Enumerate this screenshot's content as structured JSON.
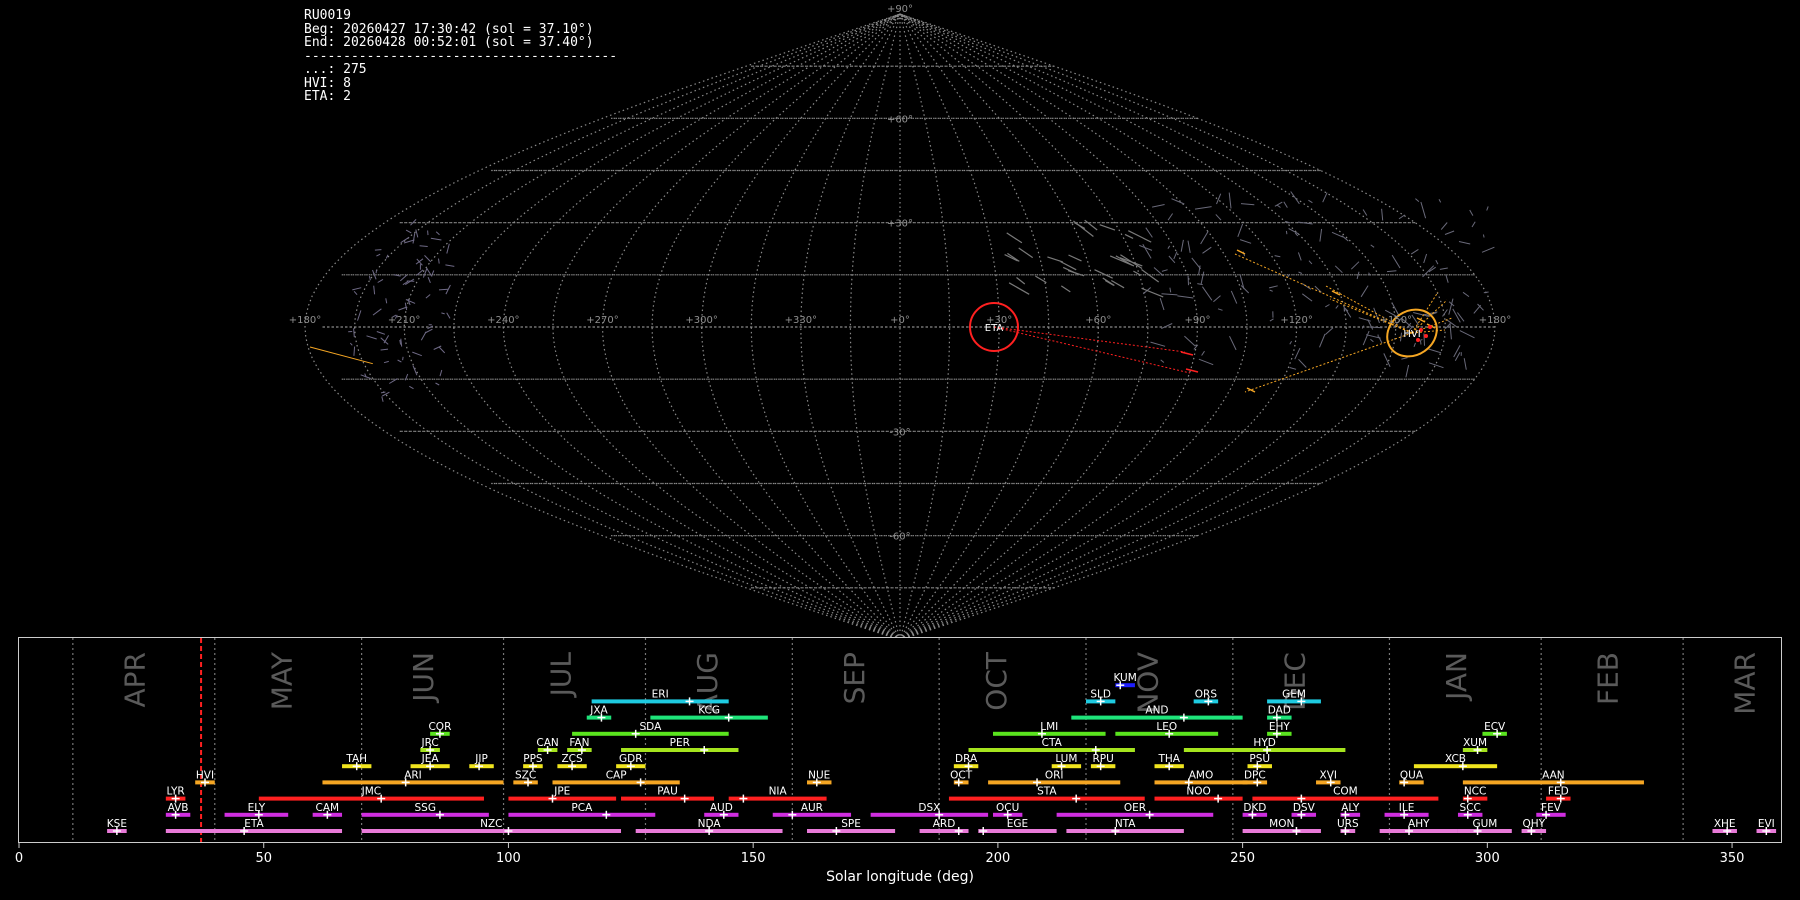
{
  "info": {
    "station": "RU0019",
    "begin": "Beg: 20260427 17:30:42 (sol = 37.10°)",
    "end": "End: 20260428 00:52:01 (sol = 37.40°)",
    "separator": "----------------------------------------",
    "counts": [
      {
        "code": "...",
        "count": 275
      },
      {
        "code": "HVI",
        "count": 8
      },
      {
        "code": "ETA",
        "count": 2
      }
    ]
  },
  "sky_map": {
    "projection": "sinusoidal",
    "lon_labels": [
      "+180°",
      "+150°",
      "+120°",
      "+90°",
      "+60°",
      "+30°",
      "+0°",
      "+330°",
      "+300°",
      "+270°",
      "+240°",
      "+210°",
      "+180°"
    ],
    "lat_labels": [
      "+90°",
      "+60°",
      "+30°",
      "-30°",
      "-60°",
      "-90°"
    ],
    "radiants": [
      {
        "code": "ETA",
        "color": "#ff2020"
      },
      {
        "code": "HVI",
        "color": "#f5a623"
      }
    ]
  },
  "chart_data": {
    "type": "range",
    "xlabel": "Solar longitude (deg)",
    "xlim": [
      0,
      360
    ],
    "xticks": [
      0,
      50,
      100,
      150,
      200,
      250,
      300,
      350
    ],
    "current_sol": 37.2,
    "months": [
      {
        "name": "APR",
        "start": 11,
        "label": 24
      },
      {
        "name": "MAY",
        "start": 40,
        "label": 54
      },
      {
        "name": "JUN",
        "start": 70,
        "label": 83
      },
      {
        "name": "JUL",
        "start": 99,
        "label": 111
      },
      {
        "name": "AUG",
        "start": 128,
        "label": 141
      },
      {
        "name": "SEP",
        "start": 158,
        "label": 171
      },
      {
        "name": "OCT",
        "start": 188,
        "label": 200
      },
      {
        "name": "NOV",
        "start": 218,
        "label": 231
      },
      {
        "name": "DEC",
        "start": 248,
        "label": 261
      },
      {
        "name": "JAN",
        "start": 280,
        "label": 294
      },
      {
        "name": "FEB",
        "start": 311,
        "label": 325
      },
      {
        "name": "MAR",
        "start": 340,
        "label": 353
      }
    ],
    "showers": [
      {
        "code": "KUM",
        "start": 224,
        "end": 228,
        "peak": 225,
        "row": 10,
        "color": "#1f1fff"
      },
      {
        "code": "ERI",
        "start": 117,
        "end": 145,
        "peak": 137,
        "row": 9,
        "color": "#1ecbe1"
      },
      {
        "code": "SLD",
        "start": 218,
        "end": 224,
        "peak": 221,
        "row": 9,
        "color": "#1ecbe1"
      },
      {
        "code": "ORS",
        "start": 240,
        "end": 245,
        "peak": 243,
        "row": 9,
        "color": "#1ecbe1"
      },
      {
        "code": "GEM",
        "start": 255,
        "end": 266,
        "peak": 262,
        "row": 9,
        "color": "#1ecbe1"
      },
      {
        "code": "JXA",
        "start": 116,
        "end": 121,
        "peak": 119,
        "row": 8,
        "color": "#1ee47a"
      },
      {
        "code": "KCG",
        "start": 129,
        "end": 153,
        "peak": 145,
        "row": 8,
        "color": "#1ee47a"
      },
      {
        "code": "AND",
        "start": 215,
        "end": 250,
        "peak": 238,
        "row": 8,
        "color": "#1ee47a"
      },
      {
        "code": "DAD",
        "start": 255,
        "end": 260,
        "peak": 257,
        "row": 8,
        "color": "#1ee47a"
      },
      {
        "code": "COR",
        "start": 84,
        "end": 88,
        "peak": 86,
        "row": 7,
        "color": "#5ae41e"
      },
      {
        "code": "SDA",
        "start": 113,
        "end": 145,
        "peak": 126,
        "row": 7,
        "color": "#5ae41e"
      },
      {
        "code": "LMI",
        "start": 199,
        "end": 222,
        "peak": 209,
        "row": 7,
        "color": "#5ae41e"
      },
      {
        "code": "LEO",
        "start": 224,
        "end": 245,
        "peak": 235,
        "row": 7,
        "color": "#5ae41e"
      },
      {
        "code": "EHY",
        "start": 255,
        "end": 260,
        "peak": 257,
        "row": 7,
        "color": "#5ae41e"
      },
      {
        "code": "ECV",
        "start": 299,
        "end": 304,
        "peak": 302,
        "row": 7,
        "color": "#5ae41e"
      },
      {
        "code": "JRC",
        "start": 82,
        "end": 86,
        "peak": 84,
        "row": 6,
        "color": "#a5e41e"
      },
      {
        "code": "CAN",
        "start": 106,
        "end": 110,
        "peak": 108,
        "row": 6,
        "color": "#a5e41e"
      },
      {
        "code": "FAN",
        "start": 112,
        "end": 117,
        "peak": 115,
        "row": 6,
        "color": "#a5e41e"
      },
      {
        "code": "PER",
        "start": 123,
        "end": 147,
        "peak": 140,
        "row": 6,
        "color": "#a5e41e"
      },
      {
        "code": "CTA",
        "start": 194,
        "end": 228,
        "peak": 220,
        "row": 6,
        "color": "#a5e41e"
      },
      {
        "code": "HYD",
        "start": 238,
        "end": 271,
        "peak": 255,
        "row": 6,
        "color": "#a5e41e"
      },
      {
        "code": "XUM",
        "start": 295,
        "end": 300,
        "peak": 298,
        "row": 6,
        "color": "#a5e41e"
      },
      {
        "code": "TAH",
        "start": 66,
        "end": 72,
        "peak": 69,
        "row": 5,
        "color": "#f0e41e"
      },
      {
        "code": "JEA",
        "start": 80,
        "end": 88,
        "peak": 84,
        "row": 5,
        "color": "#f0e41e"
      },
      {
        "code": "JIP",
        "start": 92,
        "end": 97,
        "peak": 94,
        "row": 5,
        "color": "#f0e41e"
      },
      {
        "code": "PPS",
        "start": 103,
        "end": 107,
        "peak": 105,
        "row": 5,
        "color": "#f0e41e"
      },
      {
        "code": "ZCS",
        "start": 110,
        "end": 116,
        "peak": 113,
        "row": 5,
        "color": "#f0e41e"
      },
      {
        "code": "GDR",
        "start": 122,
        "end": 128,
        "peak": 125,
        "row": 5,
        "color": "#f0e41e"
      },
      {
        "code": "DRA",
        "start": 191,
        "end": 196,
        "peak": 194,
        "row": 5,
        "color": "#f0e41e"
      },
      {
        "code": "LUM",
        "start": 211,
        "end": 217,
        "peak": 213,
        "row": 5,
        "color": "#f0e41e"
      },
      {
        "code": "RPU",
        "start": 219,
        "end": 224,
        "peak": 221,
        "row": 5,
        "color": "#f0e41e"
      },
      {
        "code": "THA",
        "start": 232,
        "end": 238,
        "peak": 235,
        "row": 5,
        "color": "#f0e41e"
      },
      {
        "code": "PSU",
        "start": 251,
        "end": 256,
        "peak": 253,
        "row": 5,
        "color": "#f0e41e"
      },
      {
        "code": "XCB",
        "start": 285,
        "end": 302,
        "peak": 295,
        "row": 5,
        "color": "#f0e41e"
      },
      {
        "code": "HVI",
        "start": 36,
        "end": 40,
        "peak": 38,
        "row": 4,
        "color": "#f5a623"
      },
      {
        "code": "ARI",
        "start": 62,
        "end": 99,
        "peak": 79,
        "row": 4,
        "color": "#f5a623"
      },
      {
        "code": "SZC",
        "start": 101,
        "end": 106,
        "peak": 104,
        "row": 4,
        "color": "#f5a623"
      },
      {
        "code": "CAP",
        "start": 109,
        "end": 135,
        "peak": 127,
        "row": 4,
        "color": "#f5a623"
      },
      {
        "code": "NUE",
        "start": 161,
        "end": 166,
        "peak": 163,
        "row": 4,
        "color": "#f5a623"
      },
      {
        "code": "OCT",
        "start": 191,
        "end": 194,
        "peak": 192,
        "row": 4,
        "color": "#f5a623"
      },
      {
        "code": "ORI",
        "start": 198,
        "end": 225,
        "peak": 208,
        "row": 4,
        "color": "#f5a623"
      },
      {
        "code": "AMO",
        "start": 232,
        "end": 251,
        "peak": 239,
        "row": 4,
        "color": "#f5a623"
      },
      {
        "code": "DPC",
        "start": 250,
        "end": 255,
        "peak": 253,
        "row": 4,
        "color": "#f5a623"
      },
      {
        "code": "XVI",
        "start": 265,
        "end": 270,
        "peak": 268,
        "row": 4,
        "color": "#f5a623"
      },
      {
        "code": "QUA",
        "start": 282,
        "end": 287,
        "peak": 283,
        "row": 4,
        "color": "#f5a623"
      },
      {
        "code": "AAN",
        "start": 295,
        "end": 332,
        "peak": 315,
        "row": 4,
        "color": "#f5a623"
      },
      {
        "code": "LYR",
        "start": 30,
        "end": 34,
        "peak": 32,
        "row": 3,
        "color": "#ff2020"
      },
      {
        "code": "JMC",
        "start": 49,
        "end": 95,
        "peak": 74,
        "row": 3,
        "color": "#ff2020"
      },
      {
        "code": "JPE",
        "start": 100,
        "end": 122,
        "peak": 109,
        "row": 3,
        "color": "#ff2020"
      },
      {
        "code": "PAU",
        "start": 123,
        "end": 142,
        "peak": 136,
        "row": 3,
        "color": "#ff2020"
      },
      {
        "code": "NIA",
        "start": 145,
        "end": 165,
        "peak": 148,
        "row": 3,
        "color": "#ff2020"
      },
      {
        "code": "STA",
        "start": 190,
        "end": 230,
        "peak": 216,
        "row": 3,
        "color": "#ff2020"
      },
      {
        "code": "NOO",
        "start": 232,
        "end": 250,
        "peak": 245,
        "row": 3,
        "color": "#ff2020"
      },
      {
        "code": "COM",
        "start": 252,
        "end": 290,
        "peak": 262,
        "row": 3,
        "color": "#ff2020"
      },
      {
        "code": "NCC",
        "start": 295,
        "end": 300,
        "peak": 296,
        "row": 3,
        "color": "#ff2020"
      },
      {
        "code": "FED",
        "start": 312,
        "end": 317,
        "peak": 315,
        "row": 3,
        "color": "#ff2020"
      },
      {
        "code": "AVB",
        "start": 30,
        "end": 35,
        "peak": 32,
        "row": 2,
        "color": "#d02ee0"
      },
      {
        "code": "ELY",
        "start": 42,
        "end": 55,
        "peak": 49,
        "row": 2,
        "color": "#d02ee0"
      },
      {
        "code": "CAM",
        "start": 60,
        "end": 66,
        "peak": 63,
        "row": 2,
        "color": "#d02ee0"
      },
      {
        "code": "SSG",
        "start": 70,
        "end": 96,
        "peak": 86,
        "row": 2,
        "color": "#d02ee0"
      },
      {
        "code": "PCA",
        "start": 100,
        "end": 130,
        "peak": 120,
        "row": 2,
        "color": "#d02ee0"
      },
      {
        "code": "AUD",
        "start": 140,
        "end": 147,
        "peak": 144,
        "row": 2,
        "color": "#d02ee0"
      },
      {
        "code": "AUR",
        "start": 154,
        "end": 170,
        "peak": 158,
        "row": 2,
        "color": "#d02ee0"
      },
      {
        "code": "DSX",
        "start": 174,
        "end": 198,
        "peak": 188,
        "row": 2,
        "color": "#d02ee0"
      },
      {
        "code": "OCU",
        "start": 199,
        "end": 205,
        "peak": 202,
        "row": 2,
        "color": "#d02ee0"
      },
      {
        "code": "OER",
        "start": 212,
        "end": 244,
        "peak": 231,
        "row": 2,
        "color": "#d02ee0"
      },
      {
        "code": "DKD",
        "start": 250,
        "end": 255,
        "peak": 252,
        "row": 2,
        "color": "#d02ee0"
      },
      {
        "code": "DSV",
        "start": 260,
        "end": 265,
        "peak": 262,
        "row": 2,
        "color": "#d02ee0"
      },
      {
        "code": "ALY",
        "start": 270,
        "end": 274,
        "peak": 271,
        "row": 2,
        "color": "#d02ee0"
      },
      {
        "code": "ILE",
        "start": 279,
        "end": 288,
        "peak": 283,
        "row": 2,
        "color": "#d02ee0"
      },
      {
        "code": "SCC",
        "start": 294,
        "end": 299,
        "peak": 296,
        "row": 2,
        "color": "#d02ee0"
      },
      {
        "code": "FEV",
        "start": 310,
        "end": 316,
        "peak": 312,
        "row": 2,
        "color": "#d02ee0"
      },
      {
        "code": "KSE",
        "start": 18,
        "end": 22,
        "peak": 20,
        "row": 1,
        "color": "#e87ad8"
      },
      {
        "code": "ETA",
        "start": 30,
        "end": 66,
        "peak": 46,
        "row": 1,
        "color": "#e87ad8"
      },
      {
        "code": "NZC",
        "start": 70,
        "end": 123,
        "peak": 100,
        "row": 1,
        "color": "#e87ad8"
      },
      {
        "code": "NDA",
        "start": 126,
        "end": 156,
        "peak": 141,
        "row": 1,
        "color": "#e87ad8"
      },
      {
        "code": "SPE",
        "start": 161,
        "end": 179,
        "peak": 167,
        "row": 1,
        "color": "#e87ad8"
      },
      {
        "code": "ARD",
        "start": 184,
        "end": 194,
        "peak": 192,
        "row": 1,
        "color": "#e87ad8"
      },
      {
        "code": "EGE",
        "start": 196,
        "end": 212,
        "peak": 197,
        "row": 1,
        "color": "#e87ad8"
      },
      {
        "code": "NTA",
        "start": 214,
        "end": 238,
        "peak": 224,
        "row": 1,
        "color": "#e87ad8"
      },
      {
        "code": "MON",
        "start": 250,
        "end": 266,
        "peak": 261,
        "row": 1,
        "color": "#e87ad8"
      },
      {
        "code": "URS",
        "start": 270,
        "end": 273,
        "peak": 271,
        "row": 1,
        "color": "#e87ad8"
      },
      {
        "code": "AHY",
        "start": 278,
        "end": 294,
        "peak": 284,
        "row": 1,
        "color": "#e87ad8"
      },
      {
        "code": "GUM",
        "start": 294,
        "end": 305,
        "peak": 298,
        "row": 1,
        "color": "#e87ad8"
      },
      {
        "code": "QHY",
        "start": 307,
        "end": 312,
        "peak": 309,
        "row": 1,
        "color": "#e87ad8"
      },
      {
        "code": "XHE",
        "start": 346,
        "end": 351,
        "peak": 349,
        "row": 1,
        "color": "#e87ad8"
      },
      {
        "code": "EVI",
        "start": 355,
        "end": 359,
        "peak": 357,
        "row": 1,
        "color": "#e87ad8"
      }
    ]
  }
}
